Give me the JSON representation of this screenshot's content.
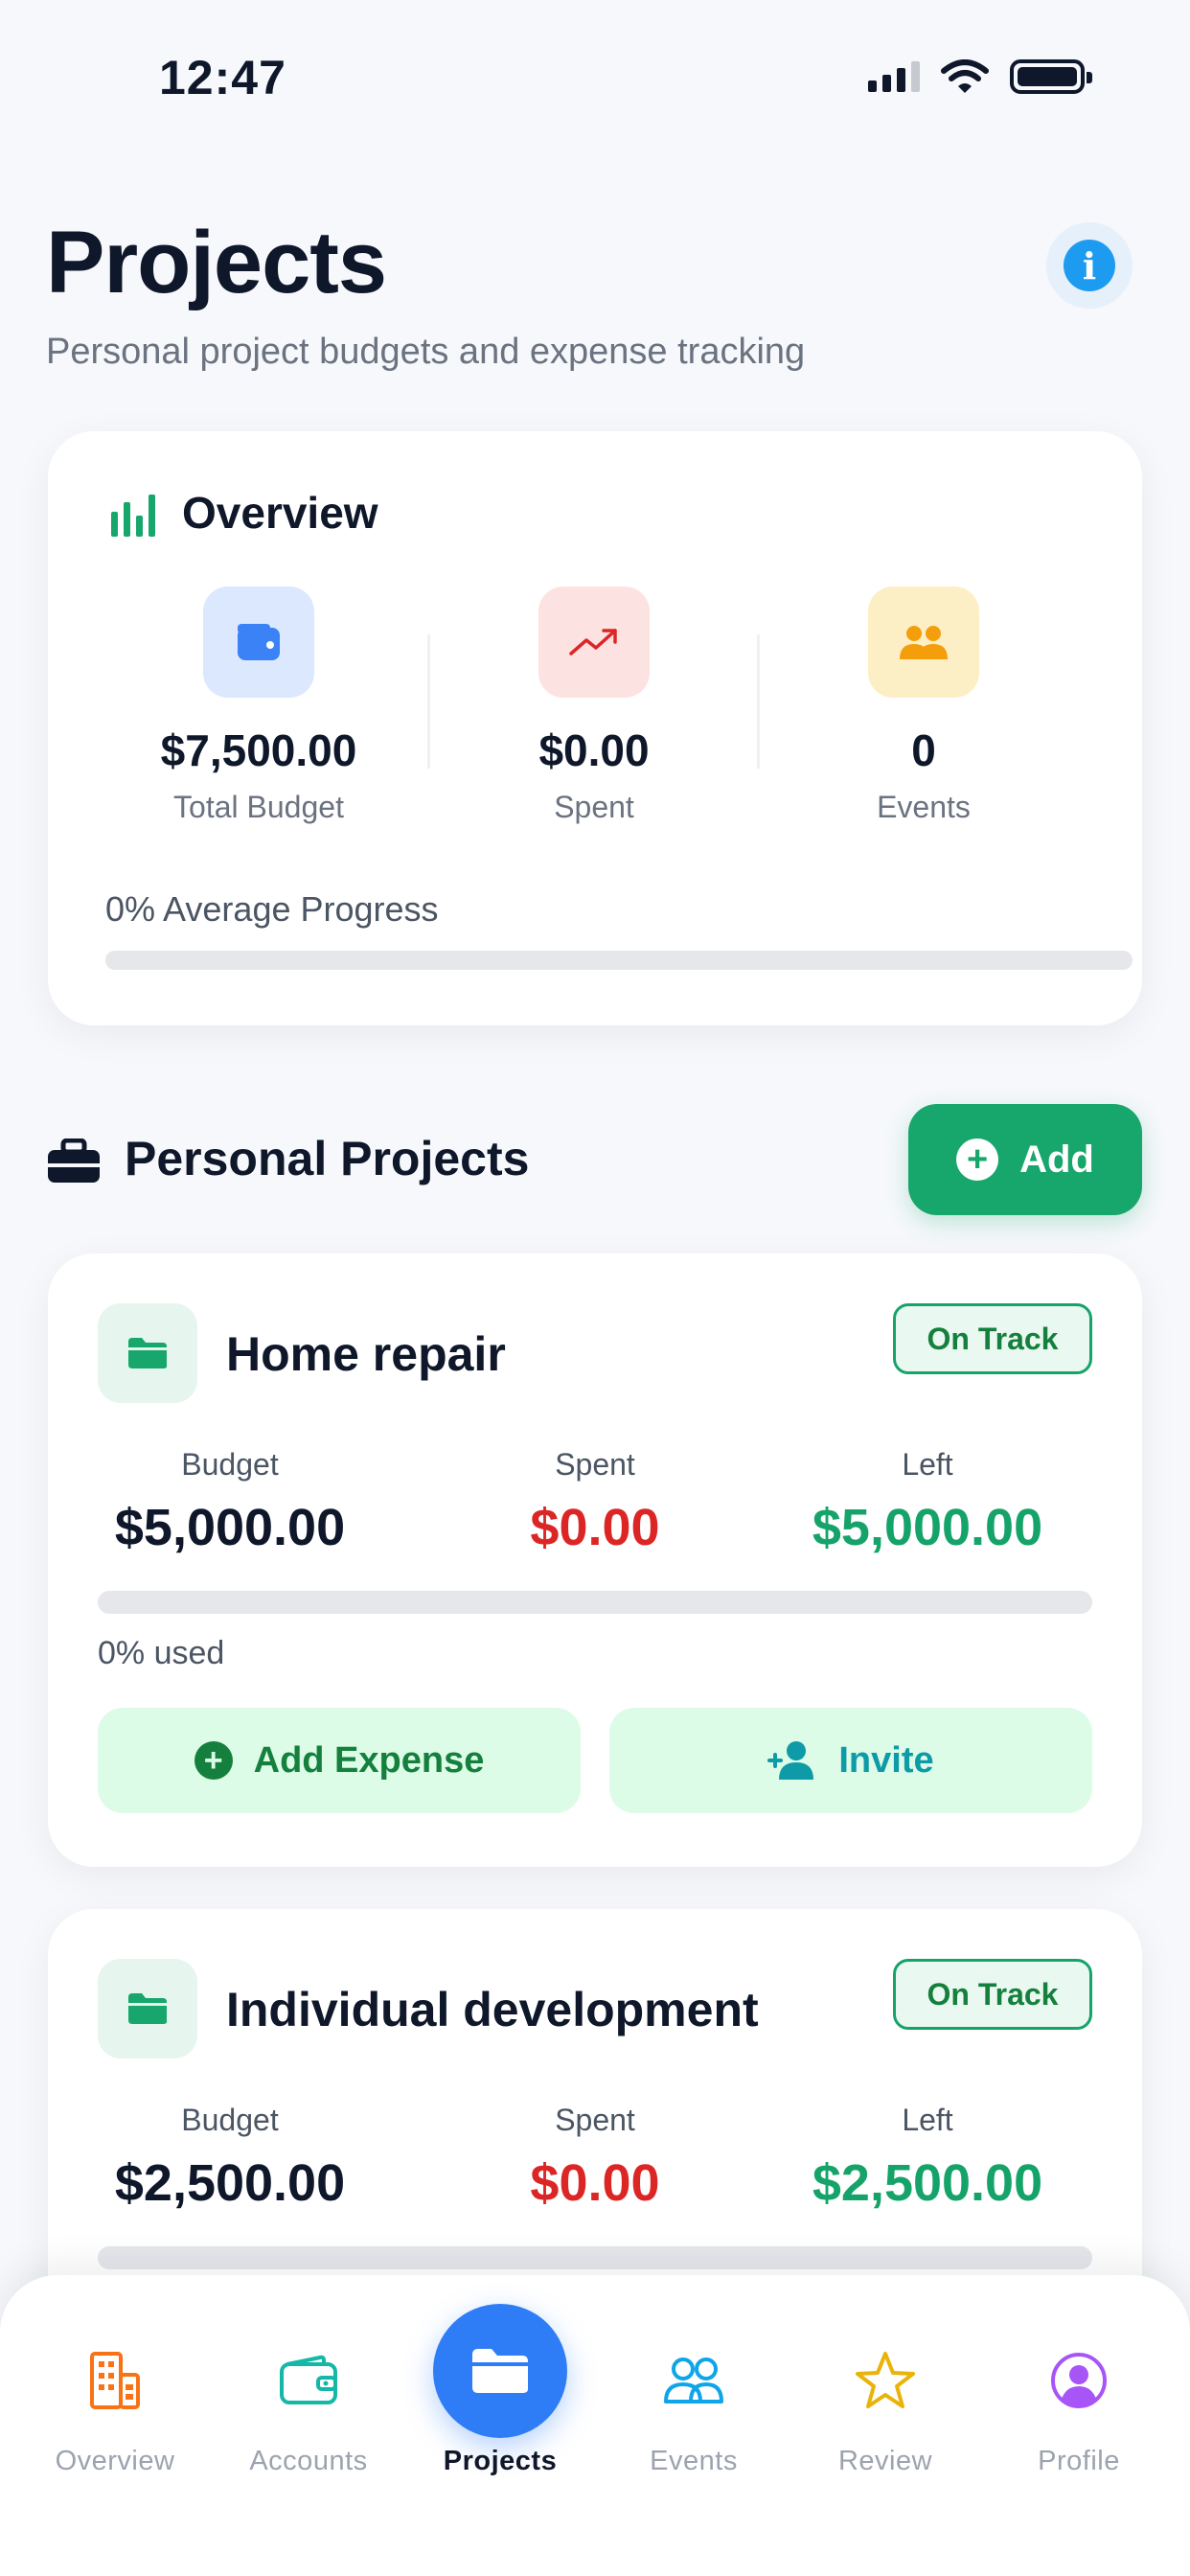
{
  "status_bar": {
    "time": "12:47"
  },
  "header": {
    "title": "Projects",
    "subtitle": "Personal project budgets and expense tracking"
  },
  "overview": {
    "title": "Overview",
    "stats": [
      {
        "value": "$7,500.00",
        "label": "Total Budget",
        "icon": "wallet-icon",
        "color": "#3b82f6"
      },
      {
        "value": "$0.00",
        "label": "Spent",
        "icon": "trending-up-icon",
        "color": "#dc2626"
      },
      {
        "value": "0",
        "label": "Events",
        "icon": "users-icon",
        "color": "#f59e0b"
      }
    ],
    "progress_label": "0% Average Progress",
    "progress": 0
  },
  "projects_section": {
    "title": "Personal Projects",
    "add_label": "Add"
  },
  "projects": [
    {
      "name": "Home repair",
      "status": "On Track",
      "budget_label": "Budget",
      "budget": "$5,000.00",
      "spent_label": "Spent",
      "spent": "$0.00",
      "left_label": "Left",
      "left": "$5,000.00",
      "used_label": "0% used",
      "used_fraction": 0,
      "add_expense_label": "Add Expense",
      "invite_label": "Invite"
    },
    {
      "name": "Individual development",
      "status": "On Track",
      "budget_label": "Budget",
      "budget": "$2,500.00",
      "spent_label": "Spent",
      "spent": "$0.00",
      "left_label": "Left",
      "left": "$2,500.00",
      "used_fraction": 0
    }
  ],
  "nav": {
    "items": [
      {
        "label": "Overview",
        "icon": "building-icon"
      },
      {
        "label": "Accounts",
        "icon": "wallet-icon"
      },
      {
        "label": "Projects",
        "icon": "folder-icon",
        "active": true
      },
      {
        "label": "Events",
        "icon": "users-icon"
      },
      {
        "label": "Review",
        "icon": "star-icon"
      },
      {
        "label": "Profile",
        "icon": "profile-icon"
      }
    ]
  },
  "colors": {
    "accent_green": "#17a66b",
    "accent_blue": "#2f7df6",
    "spent_red": "#dc2626"
  }
}
